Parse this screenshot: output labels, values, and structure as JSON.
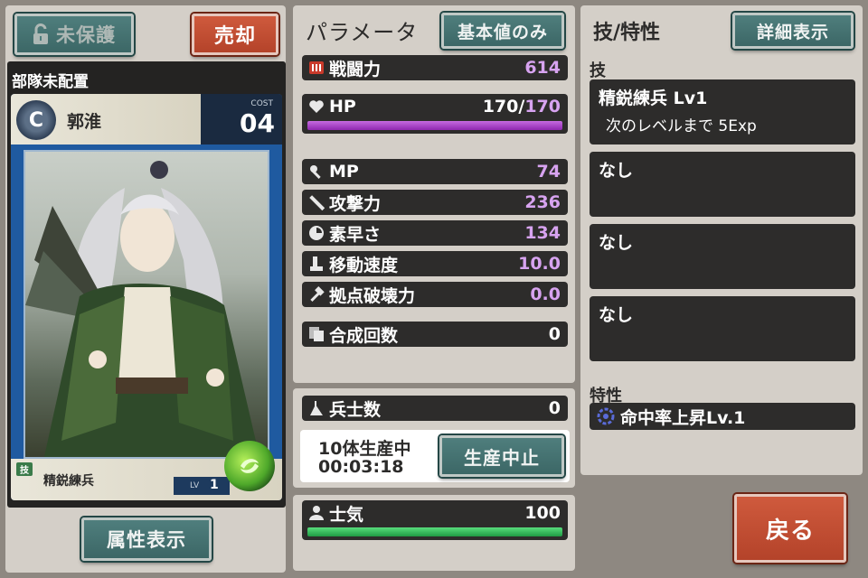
{
  "left": {
    "protect_label": "未保護",
    "sell_label": "売却",
    "deploy_status": "部隊未配置",
    "attribute_label": "属性表示",
    "card": {
      "rarity": "C",
      "name": "郭淮",
      "cost_label": "COST",
      "cost_value": "04",
      "skill_tag": "技",
      "skill_name": "精鋭練兵",
      "level_label": "LV",
      "level_value": "1"
    }
  },
  "params": {
    "title": "パラメータ",
    "base_only_label": "基本値のみ",
    "stats": [
      {
        "icon": "battle-power-icon",
        "label": "戦闘力",
        "value": "614"
      },
      {
        "icon": "heart-icon",
        "label": "HP",
        "value": "170",
        "value_max": "170",
        "sep": "/"
      },
      {
        "icon": "wrench-icon",
        "label": "MP",
        "value": "74"
      },
      {
        "icon": "sword-icon",
        "label": "攻撃力",
        "value": "236"
      },
      {
        "icon": "clock-icon",
        "label": "素早さ",
        "value": "134"
      },
      {
        "icon": "boot-icon",
        "label": "移動速度",
        "value": "10.0"
      },
      {
        "icon": "hammer-icon",
        "label": "拠点破壊力",
        "value": "0.0"
      },
      {
        "icon": "cards-icon",
        "label": "合成回数",
        "value": "0"
      }
    ],
    "hp_fill_fraction": 1.0
  },
  "troops": {
    "label": "兵士数",
    "value": "0",
    "production_status": "10体生産中",
    "production_timer": "00:03:18",
    "stop_label": "生産中止"
  },
  "morale": {
    "label": "士気",
    "value": "100",
    "fill_fraction": 1.0
  },
  "skills": {
    "title": "技/特性",
    "detail_label": "詳細表示",
    "skill_header": "技",
    "slots": [
      {
        "name": "精鋭練兵 Lv1",
        "sub": "次のレベルまで 5Exp"
      },
      {
        "name": "なし",
        "sub": ""
      },
      {
        "name": "なし",
        "sub": ""
      },
      {
        "name": "なし",
        "sub": ""
      }
    ],
    "trait_header": "特性",
    "trait": "命中率上昇Lv.1"
  },
  "back_label": "戻る",
  "colors": {
    "accent_purple": "#d7a3f0",
    "hp_bar": "#a736c6",
    "morale_bar": "#2dbf5a",
    "teal_button": "#4f7e7d",
    "red_button": "#c44f34"
  }
}
